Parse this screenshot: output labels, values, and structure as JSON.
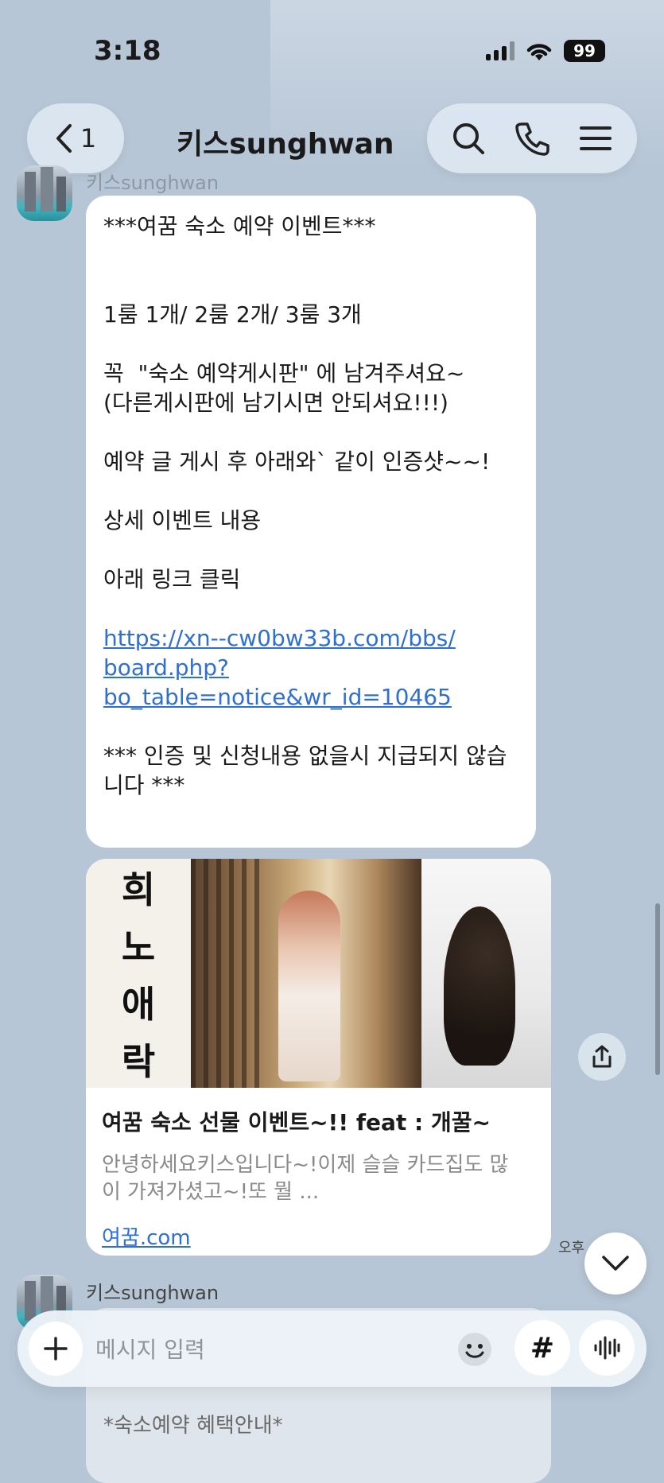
{
  "status_bar": {
    "time": "3:18",
    "battery": "99"
  },
  "header": {
    "back_count": "1",
    "title": "키스sunghwan"
  },
  "message1": {
    "sender": "키스sunghwan",
    "lines": [
      "***여꿈 숙소 예약 이벤트***",
      "",
      "",
      "1룸 1개/ 2룸 2개/ 3룸 3개",
      "",
      "꼭  \"숙소 예약게시판\" 에 남겨주셔요~",
      "(다른게시판에 남기시면 안되셔요!!!)",
      "",
      "예약 글 게시 후 아래와` 같이 인증샷~~!",
      "",
      "상세 이벤트 내용",
      "",
      "아래 링크 클릭",
      ""
    ],
    "link_lines": [
      "https://xn--cw0bw33b.com/bbs/",
      "board.php?",
      "bo_table=notice&wr_id=10465"
    ],
    "footer_lines": [
      "",
      "*** 인증 및 신청내용 없을시 지급되지 않습",
      "니다 ***"
    ]
  },
  "link_preview": {
    "calligraphy": [
      "희",
      "노",
      "애",
      "락"
    ],
    "title": "여꿈 숙소 선물 이벤트~!! feat : 개꿀~",
    "description_lines": [
      "안녕하세요키스입니다~!이제 슬슬 카드집도 많",
      "이 가져가셨고~!또 뭘 ..."
    ],
    "domain": "여꿈.com"
  },
  "time_label": "오후",
  "message2": {
    "sender": "키스sunghwan",
    "visible_text": "*숙소예약 혜택안내*"
  },
  "composer": {
    "placeholder": "메시지 입력",
    "hash_label": "#"
  },
  "icons": [
    "chevron-left-icon",
    "search-icon",
    "phone-icon",
    "menu-icon",
    "share-icon",
    "chevron-down-icon",
    "plus-icon",
    "emoji-icon",
    "voice-icon"
  ]
}
